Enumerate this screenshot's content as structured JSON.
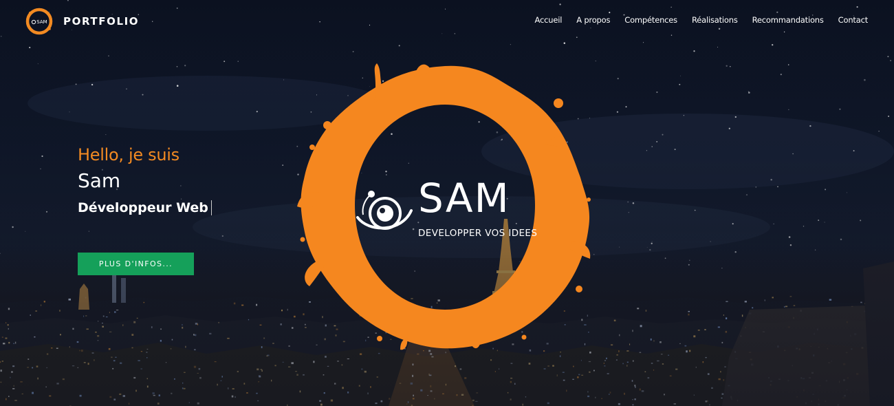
{
  "header": {
    "brand_name": "PORTFOLIO",
    "logo_text": "SAM",
    "nav": [
      "Accueil",
      "A propos",
      "Compétences",
      "Réalisations",
      "Recommandations",
      "Contact"
    ]
  },
  "intro": {
    "greeting": "Hello, je suis",
    "name": "Sam",
    "role": "Développeur Web",
    "cta_label": "PLUS D'INFOS..."
  },
  "emblem": {
    "title": "SAM",
    "tagline": "DEVELOPPER VOS IDEES"
  },
  "colors": {
    "accent": "#f28a22",
    "cta": "#15a05a",
    "text": "#ffffff"
  },
  "icons": [
    "orange-ring-logo-icon",
    "orbit-eye-logo-icon"
  ]
}
